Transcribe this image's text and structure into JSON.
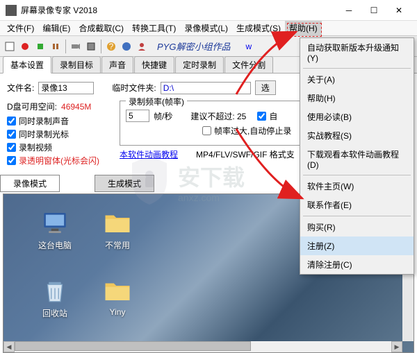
{
  "titlebar": {
    "title": "屏幕录像专家 V2018"
  },
  "menubar": {
    "items": [
      {
        "label": "文件(F)"
      },
      {
        "label": "编辑(E)"
      },
      {
        "label": "合成截取(C)"
      },
      {
        "label": "转换工具(T)"
      },
      {
        "label": "录像模式(L)"
      },
      {
        "label": "生成模式(S)"
      },
      {
        "label": "帮助(H)"
      }
    ]
  },
  "toolbar": {
    "watermark": "PYG解密小组作品",
    "link": "w"
  },
  "tabs": {
    "items": [
      {
        "label": "基本设置"
      },
      {
        "label": "录制目标"
      },
      {
        "label": "声音"
      },
      {
        "label": "快捷键"
      },
      {
        "label": "定时录制"
      },
      {
        "label": "文件分割"
      }
    ]
  },
  "panel": {
    "filename_label": "文件名:",
    "filename_value": "录像13",
    "tempdir_label": "临时文件夹:",
    "tempdir_value": "D:\\",
    "browse_btn": "选",
    "disk_label": "D盘可用空间:",
    "disk_value": "46945M",
    "freq_group": "录制频率(帧率)",
    "freq_value": "5",
    "freq_unit": "帧/秒",
    "suggest": "建议不超过:  25",
    "auto_check": "自",
    "overflow_text": "帧率过大,自动停止录",
    "chk_audio": "同时录制声音",
    "chk_cursor": "同时录制光标",
    "chk_video": "录制视频",
    "chk_trans": "录透明窗体(光标会闪)",
    "tutorial_link": "本软件动画教程",
    "format_text": "MP4/FLV/SWF/GIF 格式支"
  },
  "mode_tabs": {
    "record": "录像模式",
    "generate": "生成模式"
  },
  "desktop": {
    "icons": [
      {
        "name": "这台电脑"
      },
      {
        "name": "不常用"
      },
      {
        "name": "回收站"
      },
      {
        "name": "Yiny"
      }
    ]
  },
  "dropdown": {
    "items": [
      "自动获取新版本升级通知(Y)",
      "关于(A)",
      "帮助(H)",
      "使用必读(B)",
      "实战教程(S)",
      "下载观看本软件动画教程(D)",
      "软件主页(W)",
      "联系作者(E)",
      "购买(R)",
      "注册(Z)",
      "清除注册(C)"
    ]
  },
  "watermark_bg": {
    "main": "安下载",
    "sub": "anxz.com"
  }
}
